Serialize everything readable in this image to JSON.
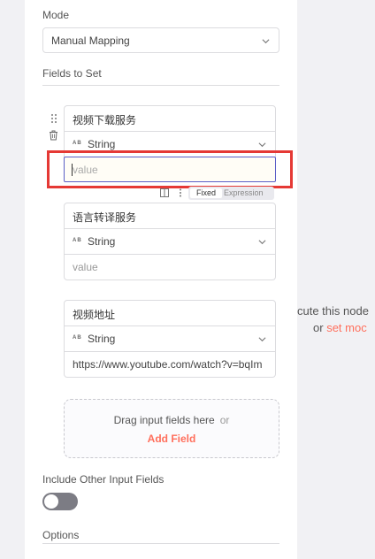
{
  "mode": {
    "label": "Mode",
    "selected": "Manual Mapping"
  },
  "fields_section": {
    "label": "Fields to Set"
  },
  "fields": [
    {
      "name": "视频下载服务",
      "type": "String",
      "value_placeholder": "value",
      "value": ""
    },
    {
      "name": "语言转译服务",
      "type": "String",
      "value_placeholder": "value",
      "value": ""
    },
    {
      "name": "视频地址",
      "type": "String",
      "value_placeholder": "",
      "value": "https://www.youtube.com/watch?v=bqIm"
    }
  ],
  "type_badge": "AB",
  "mode_toggle": {
    "fixed": "Fixed",
    "expression": "Expression"
  },
  "drop_zone": {
    "text": "Drag input fields here",
    "or": "or",
    "add": "Add Field"
  },
  "include_other": {
    "label": "Include Other Input Fields",
    "enabled": false
  },
  "options": {
    "label": "Options"
  },
  "background_hint": {
    "line1": "cute this node",
    "line2_prefix": "or",
    "line2_link": "set moc"
  },
  "colors": {
    "accent": "#ff6f5c",
    "focus": "#5b5fc7",
    "highlight": "#e53935"
  }
}
